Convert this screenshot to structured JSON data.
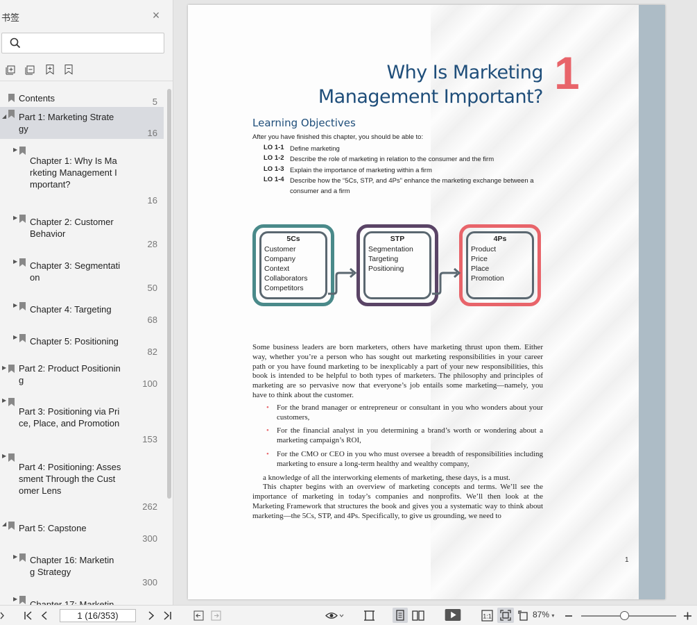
{
  "sidebar": {
    "title": "书签",
    "close_icon": "close-icon",
    "search": {
      "value": "",
      "placeholder": ""
    },
    "tools": [
      "expand-all-icon",
      "collapse-all-icon",
      "add-bookmark-icon",
      "bookmark-icon"
    ],
    "items": [
      {
        "label": "Contents",
        "page": "5"
      },
      {
        "label": "Part 1: Marketing Strate\ngy",
        "page": "16"
      },
      {
        "label": "Chapter 1: Why Is Ma\nrketing Management I\nmportant?",
        "page": "16"
      },
      {
        "label": "Chapter 2: Customer\nBehavior",
        "page": "28"
      },
      {
        "label": "Chapter 3: Segmentati\non",
        "page": "50"
      },
      {
        "label": "Chapter 4: Targeting",
        "page": "68"
      },
      {
        "label": "Chapter 5: Positioning",
        "page": "82"
      },
      {
        "label": "Part 2: Product Positionin\ng",
        "page": "100"
      },
      {
        "label": "Part 3: Positioning via Pri\nce, Place, and Promotion",
        "page": "153"
      },
      {
        "label": "Part 4: Positioning: Asses\nsment Through the Cust\nomer Lens",
        "page": "262"
      },
      {
        "label": "Part 5: Capstone",
        "page": "300"
      },
      {
        "label": "Chapter 16: Marketin\ng Strategy",
        "page": "300"
      },
      {
        "label": "Chapter 17: Marketin",
        "page": ""
      }
    ]
  },
  "page": {
    "chapter_title": "Why Is Marketing\nManagement Important?",
    "chapter_number": "1",
    "learning_objectives_title": "Learning Objectives",
    "learning_objectives_intro": "After you have finished this chapter, you should be able to:",
    "objectives": [
      {
        "code": "LO 1-1",
        "text": "Define marketing"
      },
      {
        "code": "LO 1-2",
        "text": "Describe the role of marketing in relation to the consumer and the firm"
      },
      {
        "code": "LO 1-3",
        "text": "Explain the importance of marketing within a firm"
      },
      {
        "code": "LO 1-4",
        "text": "Describe how the “5Cs, STP, and 4Ps” enhance the marketing exchange between a\nconsumer and a firm"
      }
    ],
    "framework": [
      {
        "heading": "5Cs",
        "items": "Customer\nCompany\nContext\nCollaborators\nCompetitors",
        "color": "#4a8a8a"
      },
      {
        "heading": "STP",
        "items": "Segmentation\nTargeting\nPositioning",
        "color": "#5a4466"
      },
      {
        "heading": "4Ps",
        "items": "Product\nPrice\nPlace\nPromotion",
        "color": "#e8646a"
      }
    ],
    "paragraph1": "Some business leaders are born marketers, others have marketing thrust upon them. Either way, whether you’re a person who has sought out marketing responsibilities in your career path or you have found marketing to be inexplicably a part of your new responsibilities, this book is intended to be helpful to both types of marketers. The philosophy and principles of marketing are so pervasive now that everyone’s job entails some marketing—namely, you have to think about the customer.",
    "bullets": [
      "For the brand manager or entrepreneur or consultant in you who wonders about your customers,",
      "For the financial analyst in you determining a brand’s worth or wondering about a marketing campaign’s ROI,",
      "For the CMO or CEO in you who must oversee a breadth of responsibilities including marketing to ensure a long-term healthy and wealthy company,"
    ],
    "continuation": "a knowledge of all the interworking elements of marketing, these days, is a must.",
    "paragraph2": "This chapter begins with an overview of marketing concepts and terms. We’ll see the importance of marketing in today’s companies and nonprofits. We’ll then look at the Marketing Framework that structures the book and gives you a systematic way to think about marketing—the 5Cs, STP, and 4Ps. Specifically, to give us grounding, we need to",
    "page_number": "1"
  },
  "toolbar": {
    "page_indicator": "1 (16/353)",
    "zoom": "87%",
    "zoom_level": 0.45
  }
}
